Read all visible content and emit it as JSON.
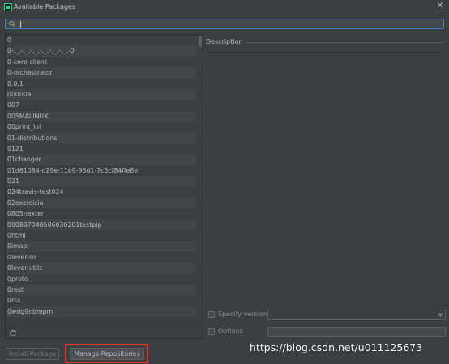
{
  "window": {
    "title": "Available Packages",
    "close_glyph": "✕",
    "accent": "#3d85c6"
  },
  "search": {
    "value": "",
    "placeholder": ""
  },
  "packages": [
    "0",
    "0-._.-._.-._.-._.-._.-._.-0",
    "0-core-client",
    "0-orchestrator",
    "0.0.1",
    "00000a",
    "007",
    "00SMALINUX",
    "00print_lol",
    "01-distributions",
    "0121",
    "01changer",
    "01d61084-d29e-11e9-96d1-7c5cf84ffe8e",
    "021",
    "024travis-test024",
    "02exercicio",
    "0805nexter",
    "090807040506030201testpip",
    "0html",
    "0imap",
    "0lever-so",
    "0lever-utils",
    "0proto",
    "0rest",
    "0rss",
    "0wdg9nbmpm",
    "0x"
  ],
  "description": {
    "label": "Description"
  },
  "options": {
    "specify_version_label": "Specify version",
    "options_label": "Options",
    "version_value": "",
    "options_value": ""
  },
  "buttons": {
    "install": "Install Package",
    "manage": "Manage Repositories"
  },
  "watermark": "https://blog.csdn.net/u011125673"
}
